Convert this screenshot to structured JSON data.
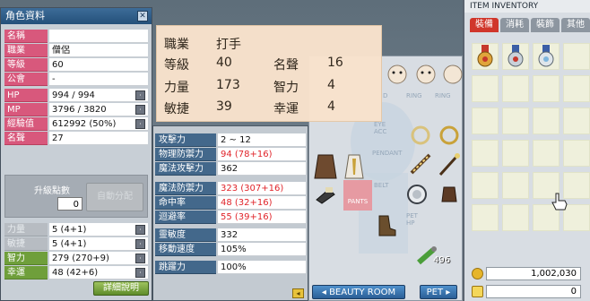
{
  "character": {
    "title": "角色資料",
    "stats": [
      {
        "label": "名稱",
        "value": ""
      },
      {
        "label": "職業",
        "value": "僧侶"
      },
      {
        "label": "等級",
        "value": "60"
      },
      {
        "label": "公會",
        "value": "-"
      },
      {
        "label": "HP",
        "value": "994 / 994"
      },
      {
        "label": "MP",
        "value": "3796 / 3820"
      },
      {
        "label": "經驗值",
        "value": "612992 (50%)"
      },
      {
        "label": "名聲",
        "value": "27"
      }
    ],
    "ap_label": "升級點數",
    "ap_value": "0",
    "auto_assign": "自動分配",
    "attributes": [
      {
        "label": "力量",
        "value": "5 (4+1)"
      },
      {
        "label": "敏捷",
        "value": "5 (4+1)"
      },
      {
        "label": "智力",
        "value": "279 (270+9)"
      },
      {
        "label": "幸運",
        "value": "48 (42+6)"
      }
    ],
    "detail_button": "詳細說明"
  },
  "details": [
    {
      "label": "攻擊力",
      "value": "2 ~ 12"
    },
    {
      "label": "物理防禦力",
      "value": "94 (78+16)"
    },
    {
      "label": "魔法攻擊力",
      "value": "362"
    },
    {
      "label": "魔法防禦力",
      "value": "323 (307+16)"
    },
    {
      "label": "命中率",
      "value": "48 (32+16)"
    },
    {
      "label": "迴避率",
      "value": "55 (39+16)"
    },
    {
      "label": "靈敏度",
      "value": "332"
    },
    {
      "label": "移動速度",
      "value": "105%"
    },
    {
      "label": "跳躍力",
      "value": "100%"
    }
  ],
  "tooltip": {
    "job_label": "職業",
    "job": "打手",
    "level_label": "等級",
    "level": "40",
    "fame_label": "名聲",
    "fame": "16",
    "str_label": "力量",
    "str": "173",
    "int_label": "智力",
    "int": "4",
    "dex_label": "敏捷",
    "dex": "39",
    "luk_label": "幸運",
    "luk": "4"
  },
  "equipment": {
    "slot_labels": [
      "D",
      "RING",
      "RING",
      "EYE\nACC",
      "PENDANT",
      "BELT",
      "PANTS",
      "PET\nHP"
    ],
    "item_count": "496",
    "beauty_room": "BEAUTY ROOM",
    "pet": "PET"
  },
  "inventory": {
    "title": "ITEM INVENTORY",
    "tabs": [
      "裝備",
      "消耗",
      "裝飾",
      "其他"
    ],
    "meso": "1,002,030",
    "points": "0"
  }
}
